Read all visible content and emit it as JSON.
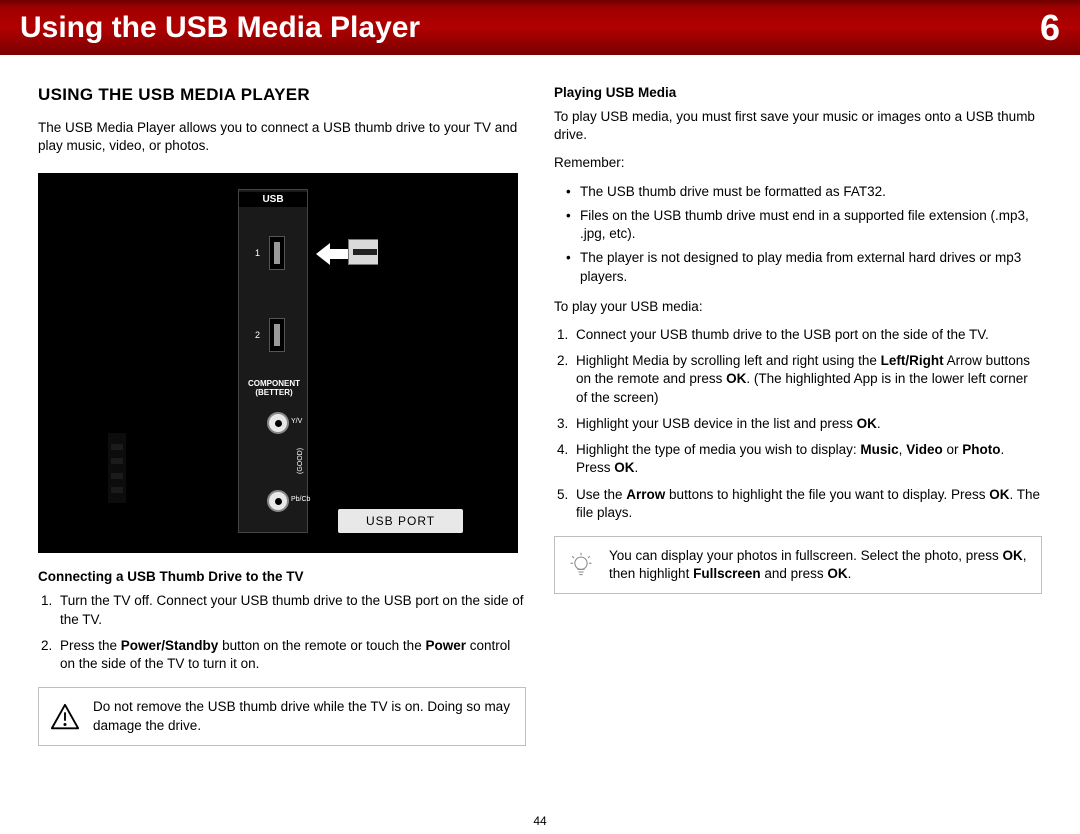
{
  "header": {
    "title": "Using the USB Media Player",
    "chapter": "6"
  },
  "left": {
    "section_title": "USING THE USB MEDIA PLAYER",
    "intro": "The USB Media Player allows you to connect a USB thumb drive to your TV and play music, video, or photos.",
    "illus": {
      "usb_label": "USB",
      "port1": "1",
      "port2": "2",
      "component": "COMPONENT",
      "better": "(BETTER)",
      "yv": "Y/V",
      "pbcb": "Pb/Cb",
      "good": "(GOOD)",
      "port_tag": "USB PORT"
    },
    "sub1": "Connecting a USB Thumb Drive to the TV",
    "steps1": {
      "s1": "Turn the TV off. Connect your USB thumb drive to the USB port on the side of the TV.",
      "s2a": "Press the ",
      "s2b": "Power/Standby",
      "s2c": " button on the remote or touch the ",
      "s2d": "Power",
      "s2e": " control on the side of the TV to turn it on."
    },
    "warn": "Do not remove the USB thumb drive while the TV is on. Doing so may damage the drive."
  },
  "right": {
    "sub2": "Playing USB Media",
    "intro2": "To play USB media, you must first save your music or images onto a USB thumb drive.",
    "remember": "Remember:",
    "bullets": {
      "b1": "The USB thumb drive must be formatted as FAT32.",
      "b2": "Files on the USB thumb drive must end in a supported file extension (.mp3, .jpg, etc).",
      "b3": "The player is not designed to play media from external hard drives or mp3 players."
    },
    "toplay": "To play your USB media:",
    "steps2": {
      "s1": "Connect your USB thumb drive to the USB port on the side of the TV.",
      "s2a": "Highlight Media by scrolling left and right using the ",
      "s2b": "Left/Right",
      "s2c": " Arrow buttons on the remote and press ",
      "s2d": "OK",
      "s2e": ". (The highlighted App is in the lower left corner of the screen)",
      "s3a": "Highlight your USB device in the list and press ",
      "s3b": "OK",
      "s3c": ".",
      "s4a": "Highlight the type of media you wish to display: ",
      "s4b": "Music",
      "s4c": ", ",
      "s4d": "Video",
      "s4e": " or ",
      "s4f": "Photo",
      "s4g": ". Press ",
      "s4h": "OK",
      "s4i": ".",
      "s5a": "Use the ",
      "s5b": "Arrow",
      "s5c": " buttons to highlight the file you want to display. Press ",
      "s5d": "OK",
      "s5e": ". The file plays."
    },
    "tip": {
      "t1": "You can display your photos in fullscreen. Select the photo, press ",
      "t2": "OK",
      "t3": ", then highlight ",
      "t4": "Fullscreen",
      "t5": " and press ",
      "t6": "OK",
      "t7": "."
    }
  },
  "page_number": "44"
}
